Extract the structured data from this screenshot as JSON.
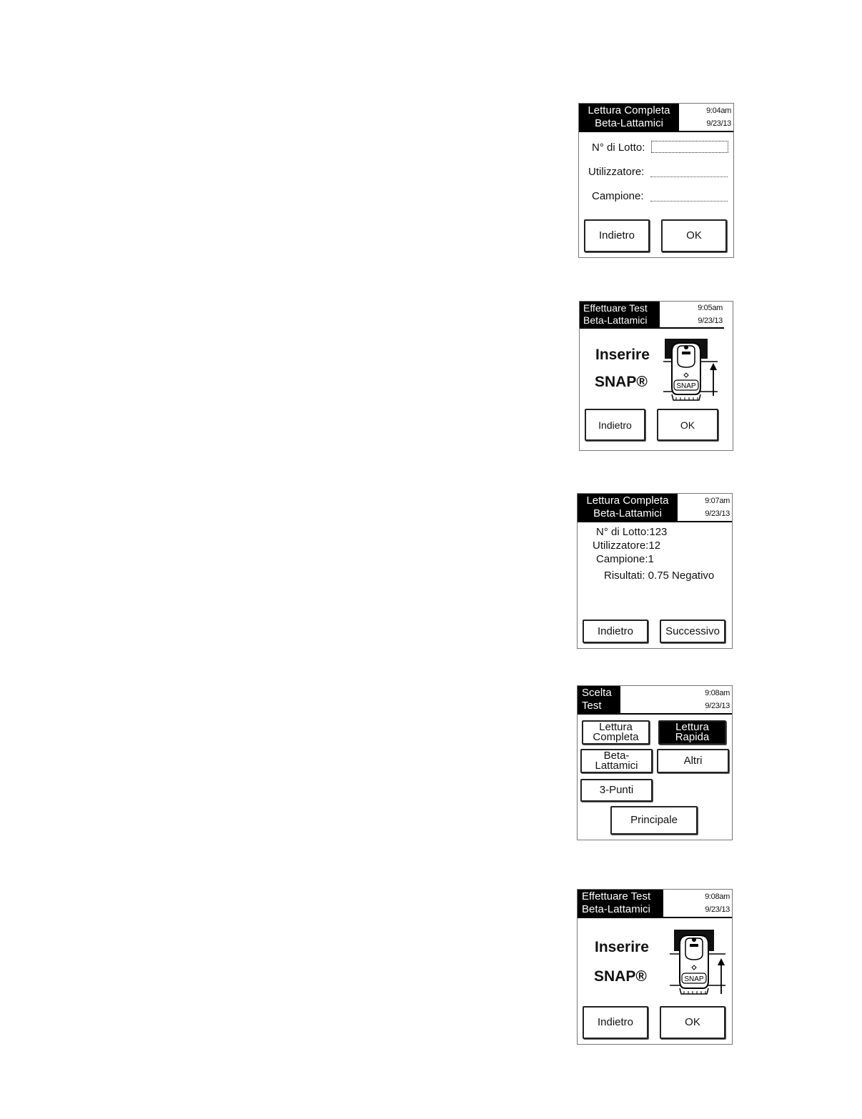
{
  "screen1": {
    "title": [
      "Lettura Completa",
      "Beta-Lattamici"
    ],
    "time": "9:04am",
    "date": "9/23/13",
    "fields": [
      {
        "label": "N° di Lotto:",
        "value": ""
      },
      {
        "label": "Utilizzatore:",
        "value": ""
      },
      {
        "label": "Campione:",
        "value": ""
      }
    ],
    "back_label": "Indietro",
    "ok_label": "OK"
  },
  "screen2": {
    "title": [
      "Effettuare Test",
      "Beta-Lattamici"
    ],
    "time": "9:05am",
    "date": "9/23/13",
    "instruction": [
      "Inserire",
      "SNAP®"
    ],
    "device_label": "SNAP",
    "back_label": "Indietro",
    "ok_label": "OK"
  },
  "screen3": {
    "title": [
      "Lettura Completa",
      "Beta-Lattamici"
    ],
    "time": "9:07am",
    "date": "9/23/13",
    "lines": [
      "N° di Lotto:123",
      "Utilizzatore:12",
      "Campione:1",
      "Risultati: 0.75  Negativo"
    ],
    "back_label": "Indietro",
    "next_label": "Successivo"
  },
  "screen4": {
    "title": [
      "Scelta",
      "Test"
    ],
    "time": "9:08am",
    "date": "9/23/13",
    "options": {
      "full_read": [
        "Lettura",
        "Completa"
      ],
      "quick_read": [
        "Lettura",
        "Rapida"
      ],
      "beta": [
        "Beta-",
        "Lattamici"
      ],
      "others": [
        "Altri"
      ],
      "three_point": [
        "3-Punti"
      ]
    },
    "main_label": "Principale"
  },
  "screen5": {
    "title": [
      "Effettuare Test",
      "Beta-Lattamici"
    ],
    "time": "9:08am",
    "date": "9/23/13",
    "instruction": [
      "Inserire",
      "SNAP®"
    ],
    "device_label": "SNAP",
    "back_label": "Indietro",
    "ok_label": "OK"
  }
}
